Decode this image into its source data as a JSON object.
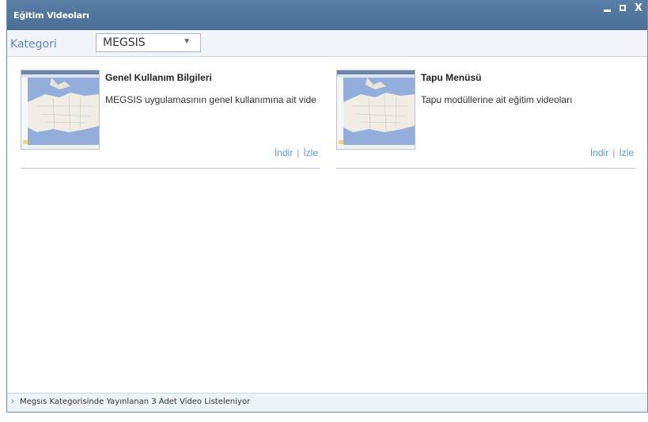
{
  "window": {
    "title": "Eğitim Videoları",
    "controls": {
      "minimize": "_",
      "maximize": "□",
      "close": "X"
    }
  },
  "toolbar": {
    "category_label": "Kategori",
    "category_value": "MEGSIS"
  },
  "videos": [
    {
      "title": "Genel Kullanım Bilgileri",
      "description": "MEGSIS uygulamasının genel kullanımına ait video",
      "download_label": "İndir",
      "separator": "|",
      "watch_label": "İzle",
      "thumbnail_icon": "map-thumbnail-icon"
    },
    {
      "title": "Tapu Menüsü",
      "description": "Tapu modüllerine ait eğitim videoları",
      "download_label": "İndir",
      "separator": "|",
      "watch_label": "İzle",
      "thumbnail_icon": "map-thumbnail-icon"
    }
  ],
  "status": {
    "text": "Megsıs Kategorisinde Yayınlanan 3 Adet Video Listeleniyor"
  },
  "colors": {
    "titlebar": "#5a7fa6",
    "link": "#5b9bd5",
    "label": "#5b86c5",
    "map_water": "#93aedb",
    "map_land": "#f0ede4"
  }
}
